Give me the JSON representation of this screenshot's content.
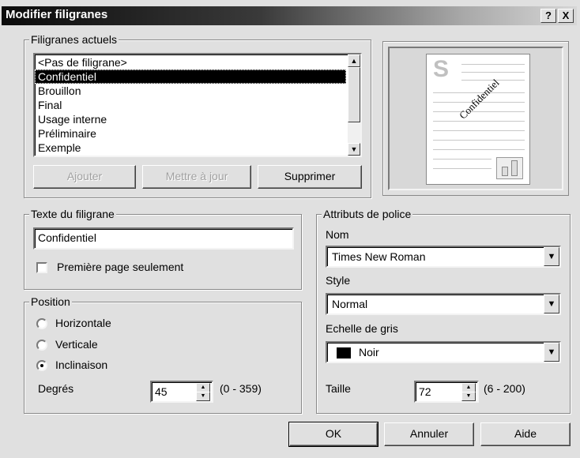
{
  "window": {
    "title": "Modifier filigranes",
    "help_label": "?",
    "close_label": "X"
  },
  "current_watermarks": {
    "legend": "Filigranes actuels",
    "items": [
      "<Pas de filigrane>",
      "Confidentiel",
      "Brouillon",
      "Final",
      "Usage interne",
      "Préliminaire",
      "Exemple"
    ],
    "selected_index": 1,
    "buttons": {
      "add": "Ajouter",
      "update": "Mettre à jour",
      "delete": "Supprimer"
    }
  },
  "preview": {
    "page_letter": "S",
    "watermark_text": "Confidentiel"
  },
  "watermark_text": {
    "legend": "Texte du filigrane",
    "value": "Confidentiel",
    "first_page_only_label": "Première page seulement",
    "first_page_only_checked": false
  },
  "position": {
    "legend": "Position",
    "options": [
      "Horizontale",
      "Verticale",
      "Inclinaison"
    ],
    "selected": "Inclinaison",
    "degrees_label": "Degrés",
    "degrees_value": "45",
    "degrees_range": "(0 - 359)"
  },
  "font_attributes": {
    "legend": "Attributs de police",
    "name_label": "Nom",
    "name_value": "Times New Roman",
    "style_label": "Style",
    "style_value": "Normal",
    "gray_label": "Echelle de gris",
    "gray_value": "Noir",
    "gray_swatch_color": "#000000",
    "size_label": "Taille",
    "size_value": "72",
    "size_range": "(6 - 200)"
  },
  "footer": {
    "ok": "OK",
    "cancel": "Annuler",
    "help": "Aide"
  }
}
